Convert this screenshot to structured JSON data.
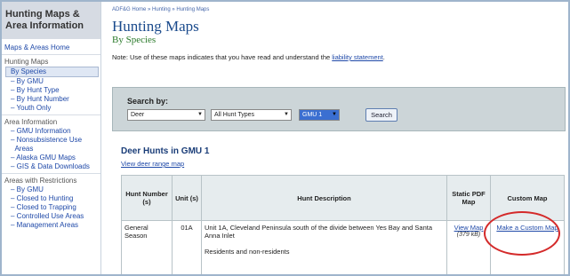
{
  "sidebar": {
    "title_line1": "Hunting Maps &",
    "title_line2": "Area Information",
    "home": "Maps & Areas Home",
    "sections": [
      {
        "label": "Hunting Maps",
        "items": [
          "By Species",
          "By GMU",
          "By Hunt Type",
          "By Hunt Number",
          "Youth Only"
        ]
      },
      {
        "label": "Area Information",
        "items": [
          "GMU Information",
          "Nonsubsistence Use",
          "Areas",
          "Alaska GMU Maps",
          "GIS & Data Downloads"
        ]
      },
      {
        "label": "Areas with Restrictions",
        "items": [
          "By GMU",
          "Closed to Hunting",
          "Closed to Trapping",
          "Controlled Use Areas",
          "Management Areas"
        ]
      }
    ]
  },
  "main": {
    "breadcrumb": "ADF&G Home » Hunting » Hunting Maps",
    "title": "Hunting Maps",
    "subtitle": "By Species",
    "note_text": "Note: Use of these maps indicates that you have read and understand the ",
    "note_link": "liability statement",
    "note_end": ".",
    "search": {
      "label": "Search by:",
      "species": "Deer",
      "hunt_type": "All Hunt Types",
      "gmu": "GMU 1",
      "button": "Search"
    },
    "results_title": "Deer Hunts in GMU 1",
    "range_link": "View deer range map",
    "table": {
      "headers": [
        "Hunt Number (s)",
        "Unit (s)",
        "Hunt Description",
        "Static PDF Map",
        "Custom Map"
      ],
      "row": {
        "hunt_number": "General Season",
        "unit": "01A",
        "desc_line1": "Unit 1A, Cleveland Peninsula south of the divide between Yes Bay and Santa Anna Inlet",
        "desc_line2": "Residents and non-residents",
        "pdf_link": "View Map",
        "pdf_size": "(379 kB)",
        "custom_link": "Make a Custom Map"
      }
    }
  }
}
